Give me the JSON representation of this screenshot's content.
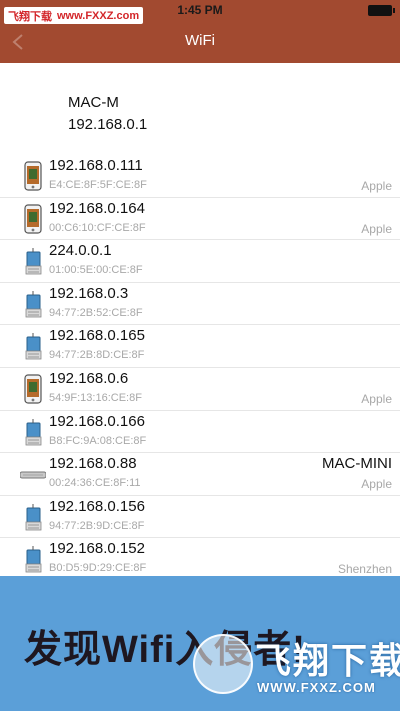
{
  "status_bar": {
    "time": "1:45 PM"
  },
  "watermark": {
    "cn": "飞翔下载",
    "url": "www.FXXZ.com"
  },
  "nav": {
    "title": "WiFi"
  },
  "current_device": {
    "name": "MAC-M",
    "ip": "192.168.0.1"
  },
  "devices": [
    {
      "ip": "192.168.0.111",
      "mac": "E4:CE:8F:5F:CE:8F",
      "name": "",
      "vendor": "Apple",
      "icon": "phone-icon"
    },
    {
      "ip": "192.168.0.164",
      "mac": "00:C6:10:CF:CE:8F",
      "name": "",
      "vendor": "Apple",
      "icon": "phone-icon"
    },
    {
      "ip": "224.0.0.1",
      "mac": "01:00:5E:00:CE:8F",
      "name": "",
      "vendor": "",
      "icon": "network-device-icon"
    },
    {
      "ip": "192.168.0.3",
      "mac": "94:77:2B:52:CE:8F",
      "name": "",
      "vendor": "",
      "icon": "network-device-icon"
    },
    {
      "ip": "192.168.0.165",
      "mac": "94:77:2B:8D:CE:8F",
      "name": "",
      "vendor": "",
      "icon": "network-device-icon"
    },
    {
      "ip": "192.168.0.6",
      "mac": "54:9F:13:16:CE:8F",
      "name": "",
      "vendor": "Apple",
      "icon": "phone-icon"
    },
    {
      "ip": "192.168.0.166",
      "mac": "B8:FC:9A:08:CE:8F",
      "name": "",
      "vendor": "",
      "icon": "network-device-icon"
    },
    {
      "ip": "192.168.0.88",
      "mac": "00:24:36:CE:8F:11",
      "name": "MAC-MINI",
      "vendor": "Apple",
      "icon": "mac-mini-icon"
    },
    {
      "ip": "192.168.0.156",
      "mac": "94:77:2B:9D:CE:8F",
      "name": "",
      "vendor": "",
      "icon": "network-device-icon"
    },
    {
      "ip": "192.168.0.152",
      "mac": "B0:D5:9D:29:CE:8F",
      "name": "",
      "vendor": "Shenzhen",
      "icon": "network-device-icon"
    }
  ],
  "banner": {
    "text": "发现Wifi入侵者!",
    "watermark_big": "飞翔下载",
    "watermark_small": "WWW.FXXZ.COM"
  },
  "colors": {
    "header": "#a24a30",
    "banner": "#5b9fd8",
    "watermark_red": "#d3262a"
  }
}
